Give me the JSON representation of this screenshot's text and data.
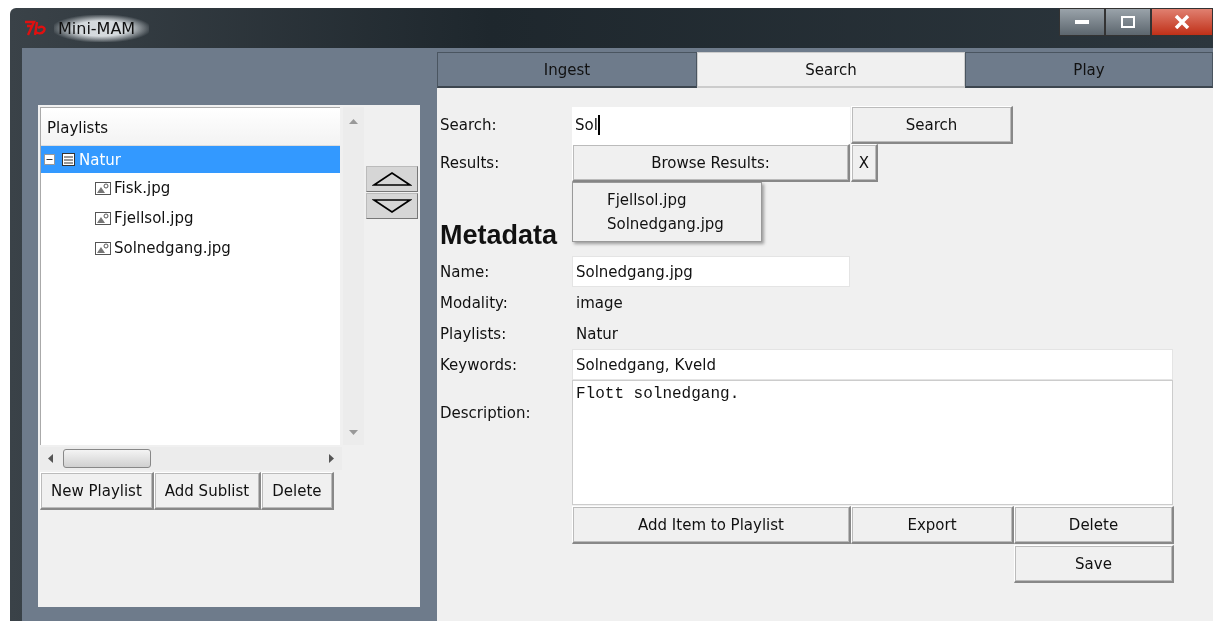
{
  "window": {
    "title": "Mini-MAM"
  },
  "playlists": {
    "header": "Playlists",
    "tree": [
      {
        "label": "Natur",
        "kind": "playlist",
        "expanded": true,
        "selected": true,
        "children": [
          {
            "label": "Fisk.jpg",
            "kind": "image",
            "selected": false
          },
          {
            "label": "Fjellsol.jpg",
            "kind": "image",
            "selected": false
          },
          {
            "label": "Solnedgang.jpg",
            "kind": "image",
            "selected": false
          }
        ]
      }
    ],
    "buttons": [
      "New Playlist",
      "Add Sublist",
      "Delete"
    ]
  },
  "tabs": [
    {
      "label": "Ingest",
      "selected": false
    },
    {
      "label": "Search",
      "selected": true
    },
    {
      "label": "Play",
      "selected": false
    }
  ],
  "search": {
    "label": "Search:",
    "value": "Sol",
    "button": "Search"
  },
  "results": {
    "label": "Results:",
    "button": "Browse Results:",
    "clear_button": "X",
    "items": [
      "Fjellsol.jpg",
      "Solnedgang.jpg"
    ]
  },
  "metadata": {
    "heading": "Metadata",
    "fields": [
      {
        "label": "Name:",
        "kind": "short_input",
        "value": "Solnedgang.jpg"
      },
      {
        "label": "Modality:",
        "kind": "text",
        "value": "image"
      },
      {
        "label": "Playlists:",
        "kind": "text",
        "value": "Natur"
      },
      {
        "label": "Keywords:",
        "kind": "long_input",
        "value": "Solnedgang, Kveld"
      },
      {
        "label": "Description:",
        "kind": "textarea",
        "value": "Flott solnedgang."
      }
    ]
  },
  "actions": [
    "Add Item to Playlist",
    "Export",
    "Delete"
  ],
  "save": "Save"
}
